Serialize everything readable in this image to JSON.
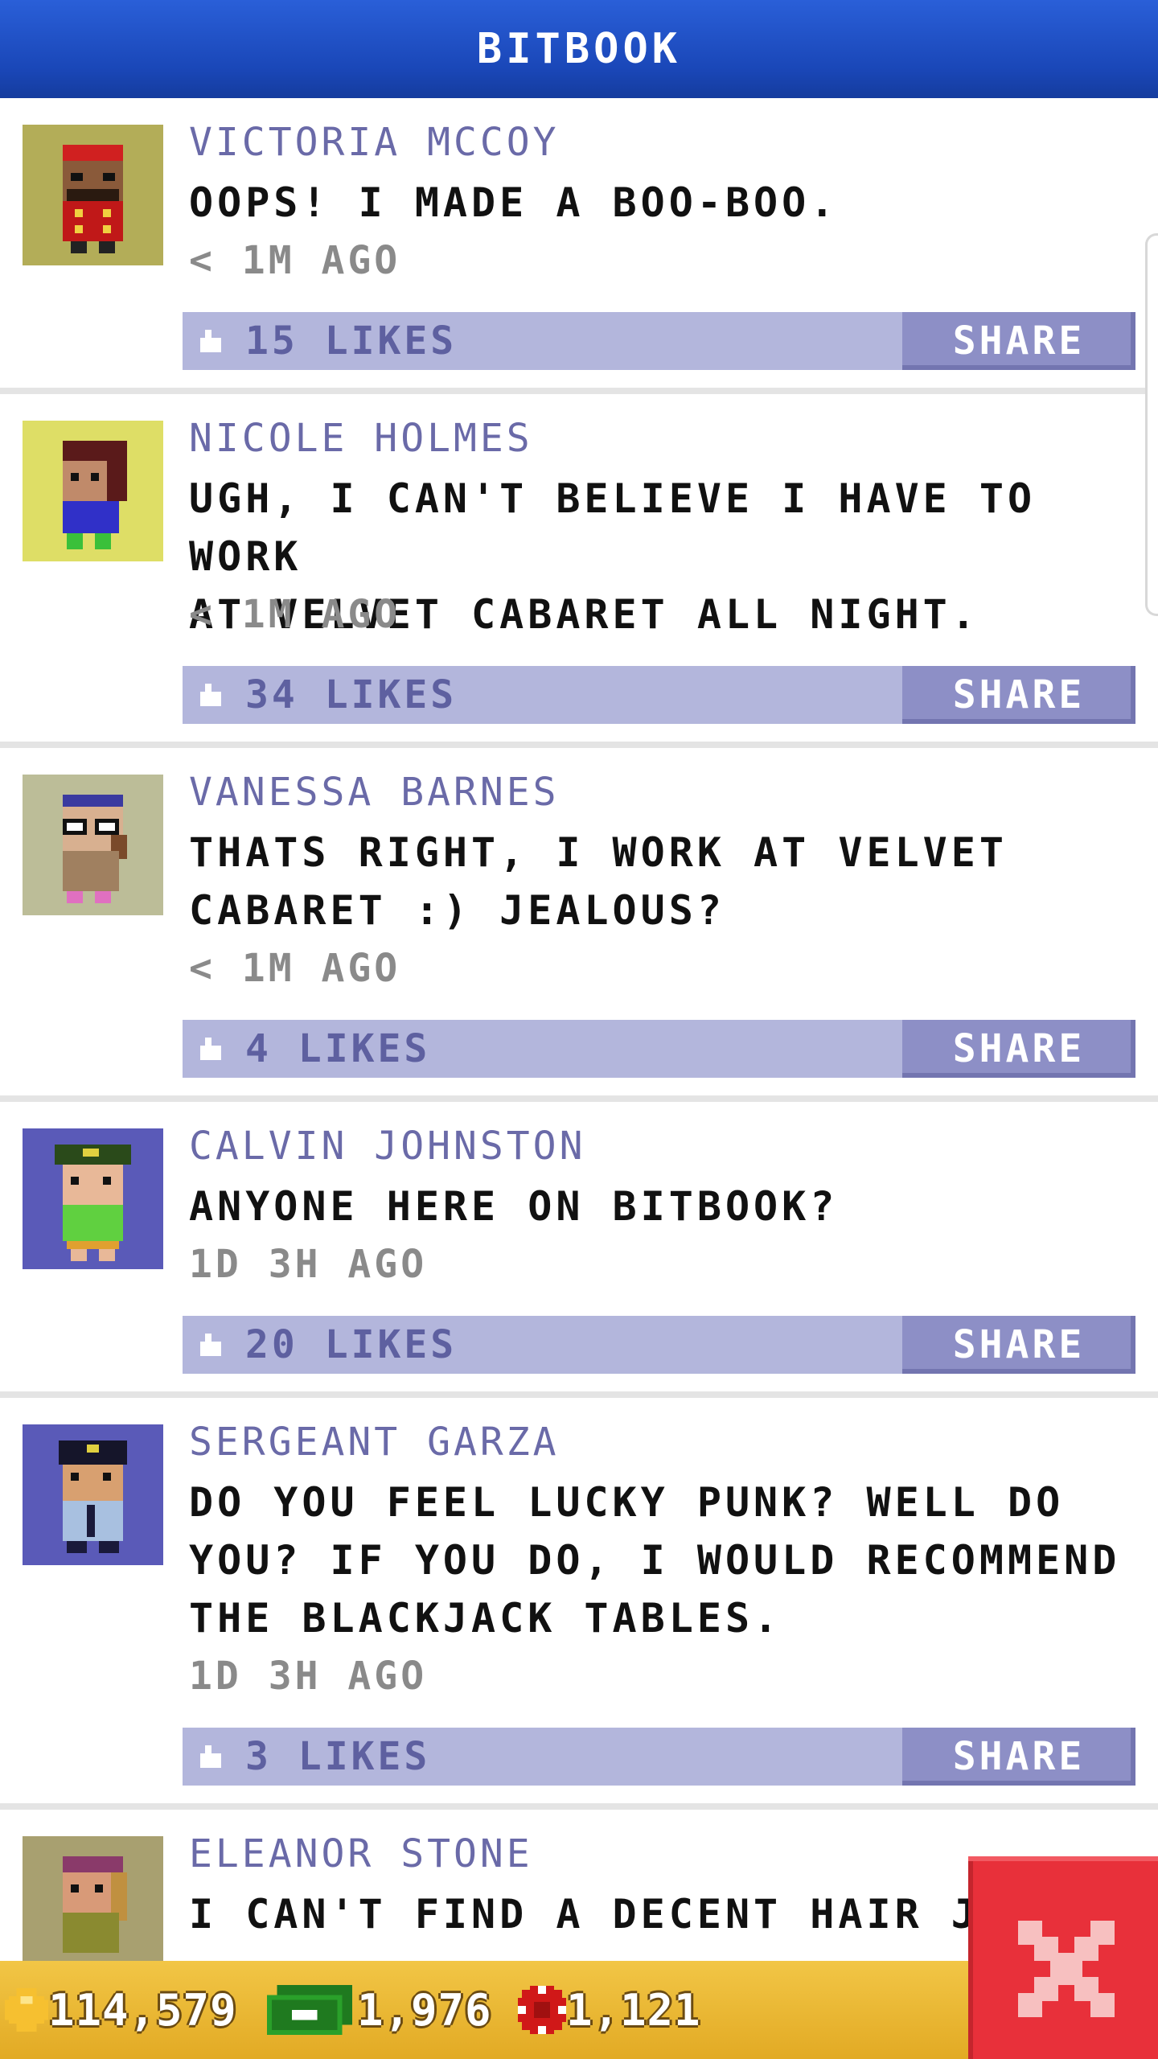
{
  "header": {
    "title": "BITBOOK"
  },
  "posts": [
    {
      "name": "VICTORIA MCCOY",
      "message": "OOPS! I MADE A BOO-BOO.",
      "time": "< 1M AGO",
      "likes": "15 LIKES",
      "share": "SHARE",
      "avatar_bg": "#b3ad58",
      "avatar_icon": "bellhop-avatar-icon"
    },
    {
      "name": "NICOLE HOLMES",
      "message": "UGH, I CAN'T BELIEVE I HAVE TO WORK\nAT VELVET CABARET ALL NIGHT.",
      "time": "< 1M AGO",
      "likes": "34 LIKES",
      "share": "SHARE",
      "avatar_bg": "#dede66",
      "avatar_icon": "girl-avatar-icon"
    },
    {
      "name": "VANESSA BARNES",
      "message": "THATS RIGHT, I WORK AT VELVET\nCABARET :) JEALOUS?",
      "time": "< 1M AGO",
      "likes": "4 LIKES",
      "share": "SHARE",
      "avatar_bg": "#bcbd98",
      "avatar_icon": "glasses-woman-avatar-icon"
    },
    {
      "name": "CALVIN JOHNSTON",
      "message": "ANYONE HERE ON BITBOOK?",
      "time": "1D 3H AGO",
      "likes": "20 LIKES",
      "share": "SHARE",
      "avatar_bg": "#5a5ab8",
      "avatar_icon": "cap-boy-avatar-icon"
    },
    {
      "name": "SERGEANT GARZA",
      "message": "DO YOU FEEL LUCKY PUNK? WELL DO\nYOU? IF YOU DO, I WOULD RECOMMEND\nTHE BLACKJACK TABLES.",
      "time": "1D 3H AGO",
      "likes": "3 LIKES",
      "share": "SHARE",
      "avatar_bg": "#5a5ab8",
      "avatar_icon": "police-officer-avatar-icon"
    },
    {
      "name": "ELEANOR STONE",
      "message": "I CAN'T FIND A DECENT HAIR JEL",
      "time": "",
      "likes": "",
      "share": "",
      "avatar_bg": "#a8a070",
      "avatar_icon": "woman-avatar-icon"
    }
  ],
  "currency": {
    "coins": "114,579",
    "bux": "1,976",
    "tokens": "1,121"
  },
  "colors": {
    "header": "#1a47b8",
    "likebar": "#b3b6dc",
    "share": "#8d8fc6",
    "close": "#e8303a"
  }
}
